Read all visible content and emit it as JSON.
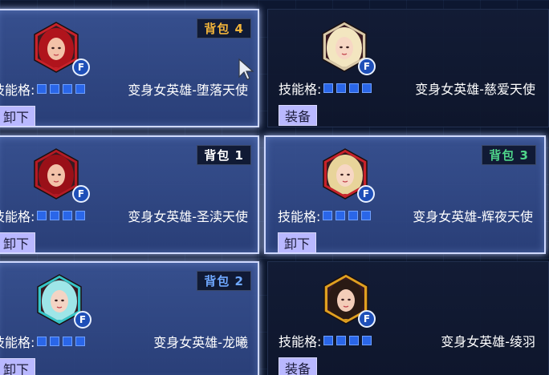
{
  "skill_label": "技能格:",
  "cards": [
    {
      "bag": "背包 4",
      "bag_color": "#f2b43a",
      "name": "变身女英雄-堕落天使",
      "button": "卸下",
      "state": "equipped",
      "frame_color": "#c8222a",
      "hair": "#b0141c",
      "skin": "#f3c2a8",
      "f": "F"
    },
    {
      "bag": "",
      "bag_color": "",
      "name": "变身女英雄-慈爱天使",
      "button": "装备",
      "state": "unequipped",
      "frame_color": "#d9c9a8",
      "hair": "#f3e6c0",
      "skin": "#f7d7c4",
      "f": "F"
    },
    {
      "bag": "背包 1",
      "bag_color": "#ffffff",
      "name": "变身女英雄-圣渎天使",
      "button": "卸下",
      "state": "equipped",
      "frame_color": "#b51a24",
      "hair": "#9a1018",
      "skin": "#f3c2a8",
      "f": "F"
    },
    {
      "bag": "背包 3",
      "bag_color": "#4fd58a",
      "name": "变身女英雄-辉夜天使",
      "button": "卸下",
      "state": "equipped",
      "frame_color": "#c8222a",
      "hair": "#e8d49a",
      "skin": "#f7d7c4",
      "f": "F"
    },
    {
      "bag": "背包 2",
      "bag_color": "#6fa8ff",
      "name": "变身女英雄-龙曦",
      "button": "卸下",
      "state": "equipped",
      "frame_color": "#36c6c8",
      "hair": "#9ee6e8",
      "skin": "#f4d4c4",
      "f": "F"
    },
    {
      "bag": "",
      "bag_color": "",
      "name": "变身女英雄-绫羽",
      "button": "装备",
      "state": "unequipped",
      "frame_color": "#e0a020",
      "hair": "#2a1a14",
      "skin": "#f3cdb8",
      "f": "F"
    }
  ],
  "slot_count": 4
}
